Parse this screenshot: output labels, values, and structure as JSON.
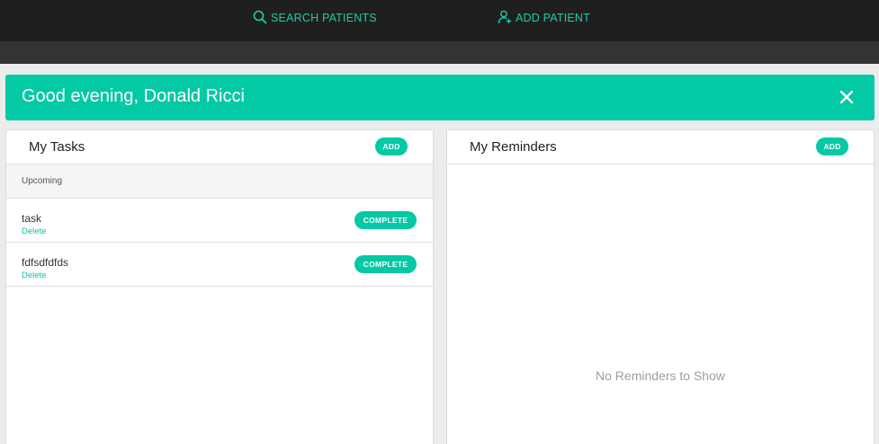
{
  "nav": {
    "search_label": "SEARCH PATIENTS",
    "add_patient_label": "ADD PATIENT"
  },
  "greeting": {
    "text": "Good evening, Donald Ricci"
  },
  "tasks": {
    "title": "My Tasks",
    "add_label": "ADD",
    "section_label": "Upcoming",
    "items": [
      {
        "name": "task",
        "delete_label": "Delete",
        "complete_label": "COMPLETE"
      },
      {
        "name": "fdfsdfdfds",
        "delete_label": "Delete",
        "complete_label": "COMPLETE"
      }
    ]
  },
  "reminders": {
    "title": "My Reminders",
    "add_label": "ADD",
    "empty_message": "No Reminders to Show"
  },
  "colors": {
    "accent": "#04c9a5",
    "nav_link": "#1ecda8",
    "topbar": "#1f1f1f"
  },
  "icons": {
    "search": "search-icon",
    "add_patient": "add-person-icon",
    "close": "close-icon"
  }
}
